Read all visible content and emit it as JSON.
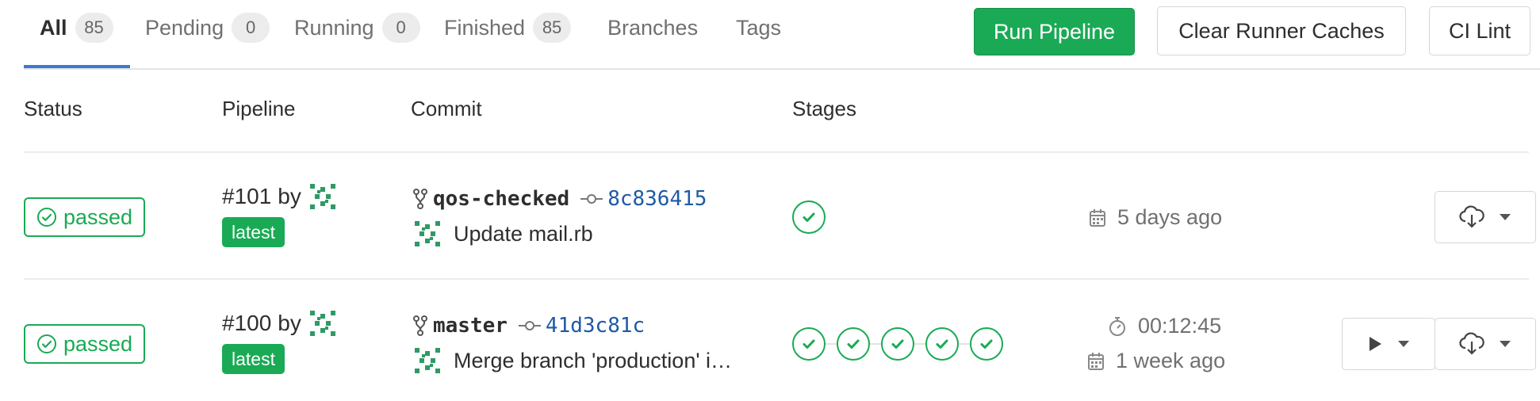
{
  "tabs": [
    {
      "label": "All",
      "count": "85"
    },
    {
      "label": "Pending",
      "count": "0"
    },
    {
      "label": "Running",
      "count": "0"
    },
    {
      "label": "Finished",
      "count": "85"
    },
    {
      "label": "Branches"
    },
    {
      "label": "Tags"
    }
  ],
  "toolbar": {
    "run_pipeline": "Run Pipeline",
    "clear_caches": "Clear Runner Caches",
    "ci_lint": "CI Lint"
  },
  "table": {
    "headers": {
      "status": "Status",
      "pipeline": "Pipeline",
      "commit": "Commit",
      "stages": "Stages"
    }
  },
  "rows": [
    {
      "status": "passed",
      "pipeline": "#101",
      "by": "by",
      "tag": "latest",
      "branch": "qos-checked",
      "sha": "8c836415",
      "message": "Update mail.rb",
      "stages": 1,
      "duration": "",
      "finished": "5 days ago"
    },
    {
      "status": "passed",
      "pipeline": "#100",
      "by": "by",
      "tag": "latest",
      "branch": "master",
      "sha": "41d3c81c",
      "message": "Merge branch 'production' i…",
      "stages": 5,
      "duration": "00:12:45",
      "finished": "1 week ago"
    }
  ],
  "colors": {
    "success": "#1aaa55",
    "link": "#1f5aa6",
    "accent": "#3f78d3"
  },
  "icons": [
    "check-circle-icon",
    "fork-icon",
    "commit-icon",
    "calendar-icon",
    "timer-icon",
    "play-icon",
    "download-icon",
    "chevron-down-icon"
  ]
}
